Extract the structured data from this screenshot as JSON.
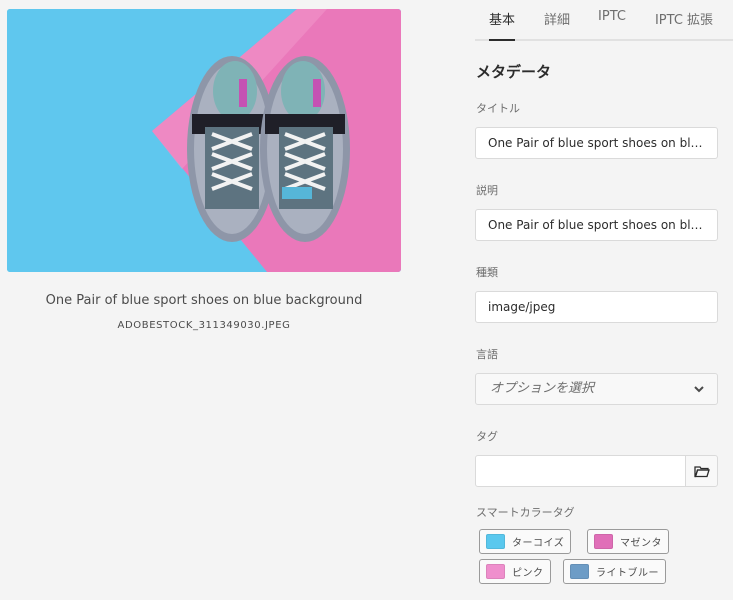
{
  "preview": {
    "asset_title": "One Pair of blue sport shoes on blue background",
    "filename": "ADOBESTOCK_311349030.JPEG"
  },
  "tabs": [
    {
      "label": "基本",
      "active": true
    },
    {
      "label": "詳細",
      "active": false
    },
    {
      "label": "IPTC",
      "active": false
    },
    {
      "label": "IPTC 拡張",
      "active": false
    }
  ],
  "metadata": {
    "heading": "メタデータ",
    "title_label": "タイトル",
    "title_value": "One Pair of blue sport shoes on blue background",
    "description_label": "説明",
    "description_value": "One Pair of blue sport shoes on blue background",
    "type_label": "種類",
    "type_value": "image/jpeg",
    "language_label": "言語",
    "language_placeholder": "オプションを選択",
    "tags_label": "タグ",
    "tags_value": "",
    "smart_color_label": "スマートカラータグ"
  },
  "smart_color_tags": [
    {
      "name": "ターコイズ",
      "color": "#5ac8ee"
    },
    {
      "name": "マゼンタ",
      "color": "#e06fb8"
    },
    {
      "name": "ピンク",
      "color": "#ef8fcd"
    },
    {
      "name": "ライトブルー",
      "color": "#6d9cc6"
    }
  ]
}
